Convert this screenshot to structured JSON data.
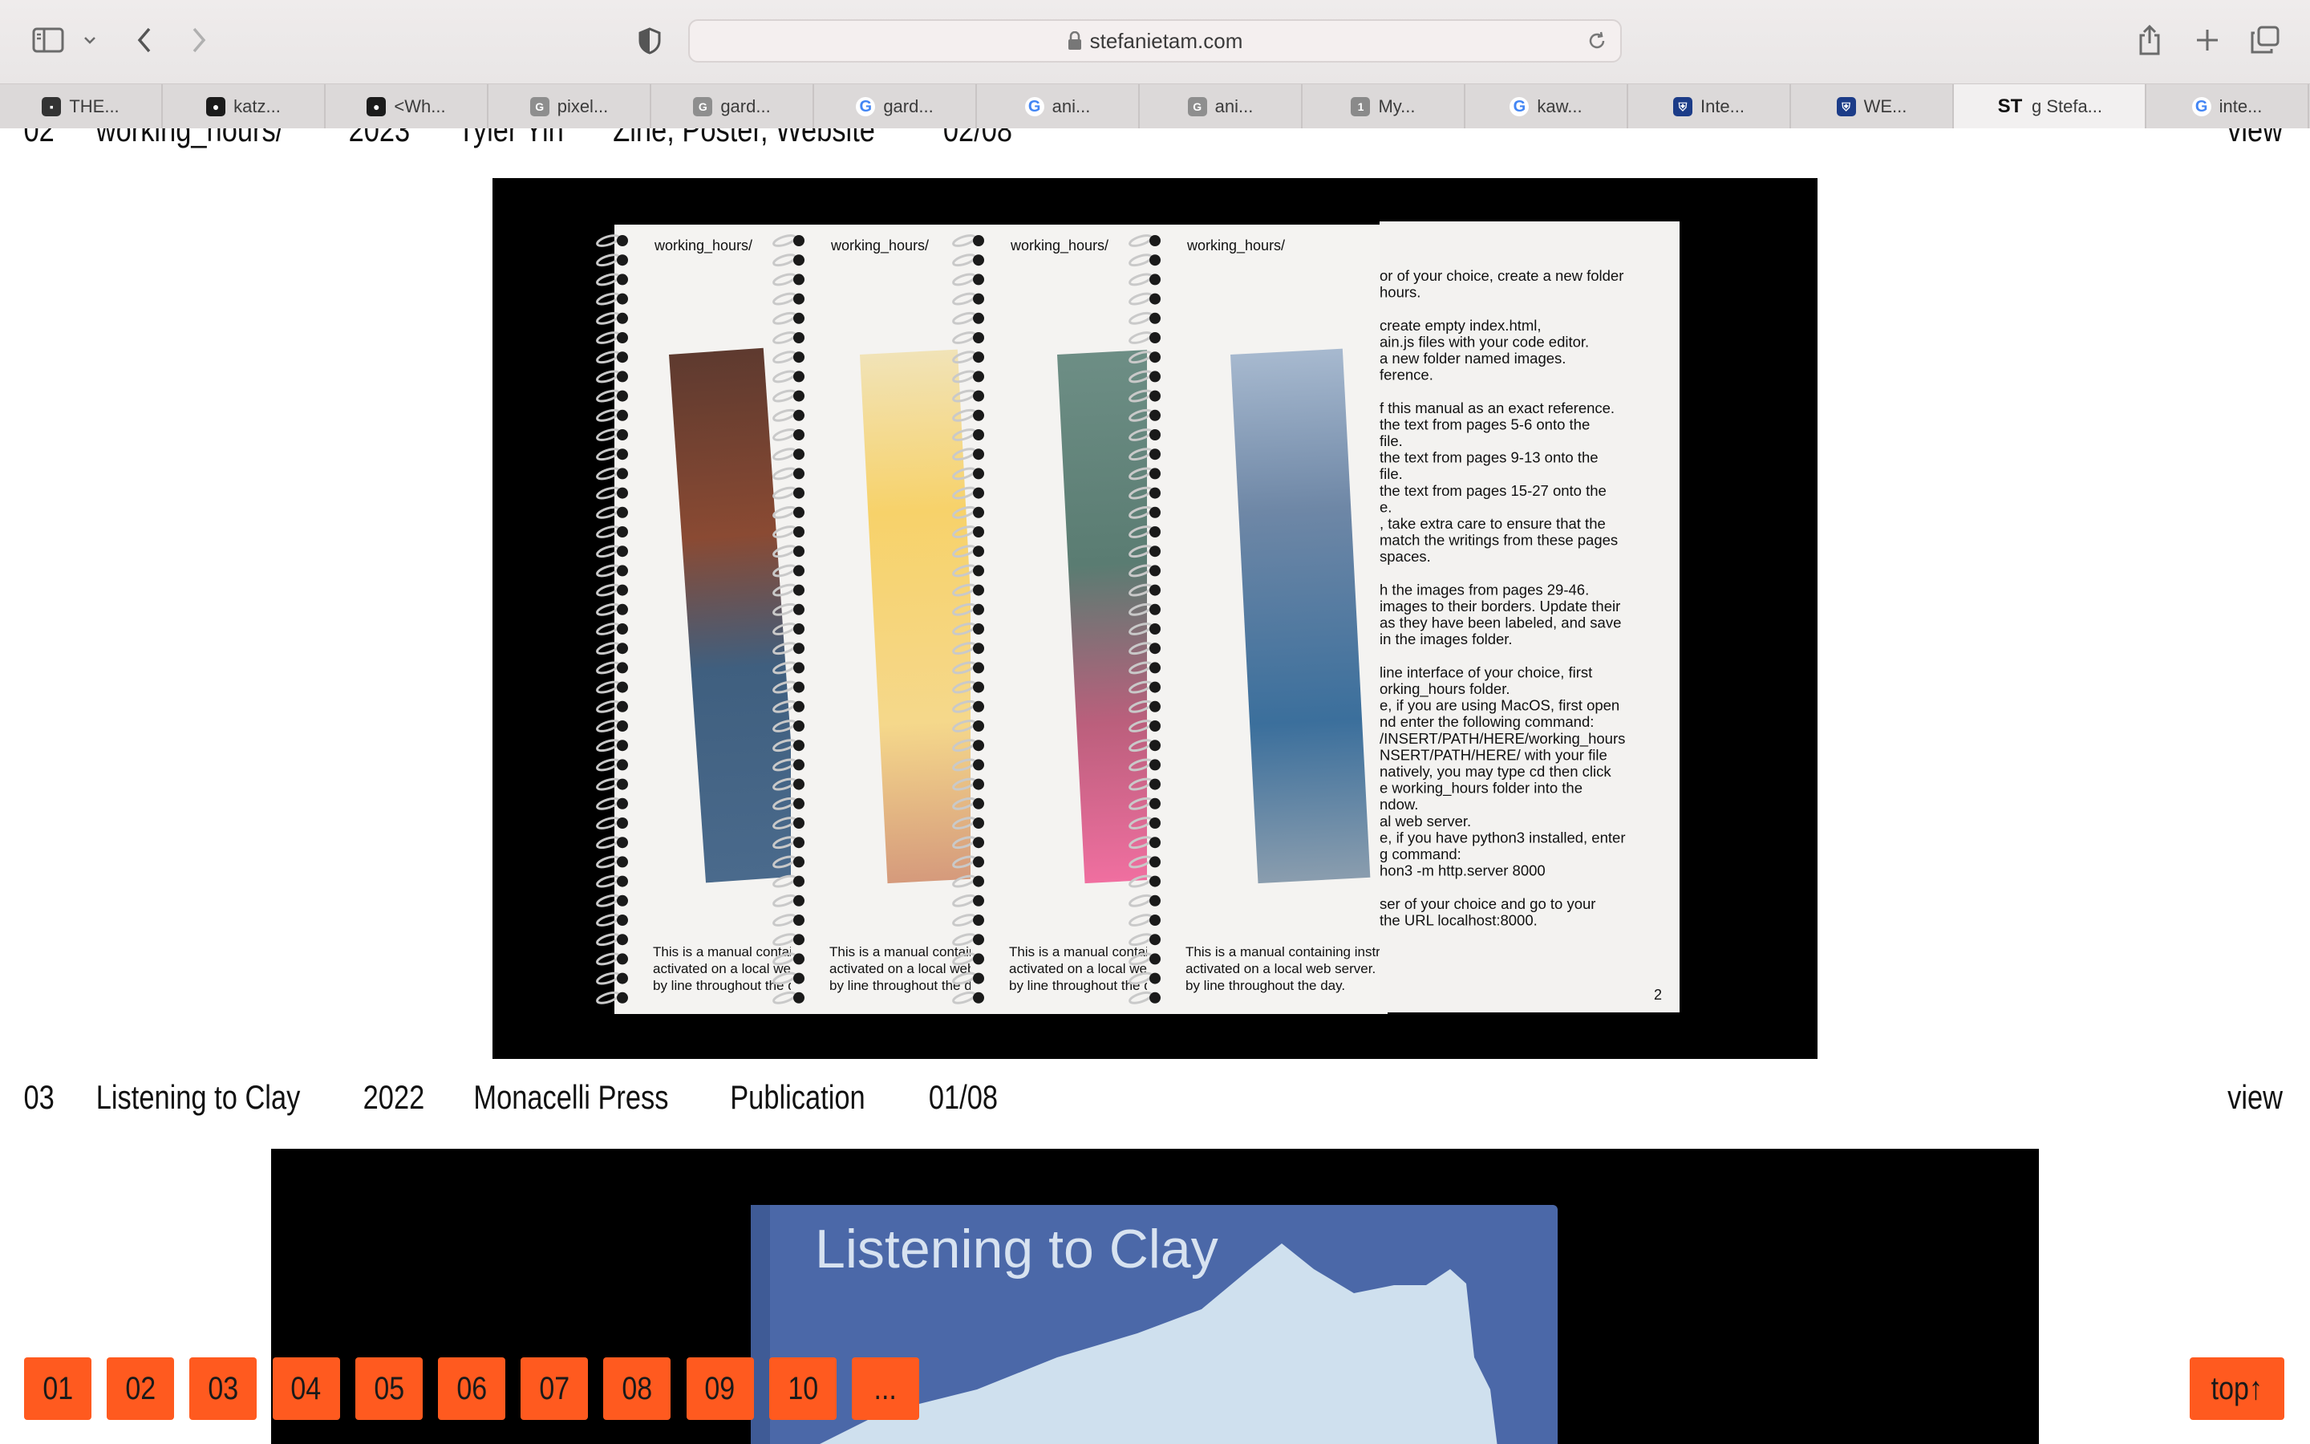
{
  "browser": {
    "url": "stefanietam.com",
    "tabs": [
      {
        "label": "THE...",
        "icon": "dark-square-icon"
      },
      {
        "label": "katz...",
        "icon": "github-icon"
      },
      {
        "label": "<Wh...",
        "icon": "github-icon"
      },
      {
        "label": "pixel...",
        "icon": "gray-g-icon"
      },
      {
        "label": "gard...",
        "icon": "gray-g-icon"
      },
      {
        "label": "gard...",
        "icon": "google-icon"
      },
      {
        "label": "ani...",
        "icon": "google-icon"
      },
      {
        "label": "ani...",
        "icon": "gray-g-icon"
      },
      {
        "label": "My...",
        "icon": "number-one-icon"
      },
      {
        "label": "kaw...",
        "icon": "google-icon"
      },
      {
        "label": "Inte...",
        "icon": "university-crest-icon"
      },
      {
        "label": "WE...",
        "icon": "university-crest-icon"
      },
      {
        "label": "g Stefa...",
        "icon": "st-icon",
        "active": true
      },
      {
        "label": "inte...",
        "icon": "google-icon"
      }
    ]
  },
  "projects": [
    {
      "num": "02",
      "title": "working_hours/",
      "year": "2023",
      "client": "Tyler Yin",
      "type": "Zine, Poster, Website",
      "count": "02/08",
      "view": "view"
    },
    {
      "num": "03",
      "title": "Listening to Clay",
      "year": "2022",
      "client": "Monacelli Press",
      "type": "Publication",
      "count": "01/08",
      "view": "view"
    }
  ],
  "zine": {
    "header": "working_hours/",
    "caption": [
      "This is a manual containing instructions for a website",
      "activated on a local web server. Each webpage is built line",
      "by line throughout the day."
    ],
    "instructions": [
      "or of your choice, create a new folder",
      "hours.",
      "",
      "create empty index.html,",
      "ain.js files with your code editor.",
      "a new folder named images.",
      "ference.",
      "",
      "f this manual as an exact reference.",
      "the text from pages 5-6 onto the",
      "file.",
      "the text from pages 9-13 onto the",
      "file.",
      "the text from pages 15-27 onto the",
      "e.",
      ", take extra care to ensure that the",
      "match the writings from these pages",
      "spaces.",
      "",
      "h the images from pages 29-46.",
      "images to their borders. Update their",
      "as they have been labeled, and save",
      "in the images folder.",
      "",
      "line interface of your choice, first",
      "orking_hours folder.",
      "e, if you are using MacOS, first open",
      "nd enter the following command:",
      "/INSERT/PATH/HERE/working_hours",
      "NSERT/PATH/HERE/ with your file",
      "natively, you may type cd then click",
      "e working_hours folder into the",
      "ndow.",
      "al web server.",
      "e, if you have python3 installed, enter",
      "g command:",
      "hon3 -m http.server 8000",
      "",
      "ser of your choice and go to your",
      "the URL localhost:8000."
    ],
    "page_number": "2"
  },
  "book": {
    "cover_title": "Listening to Clay"
  },
  "nav": {
    "buttons": [
      "01",
      "02",
      "03",
      "04",
      "05",
      "06",
      "07",
      "08",
      "09",
      "10",
      "..."
    ],
    "top": "top↑"
  }
}
